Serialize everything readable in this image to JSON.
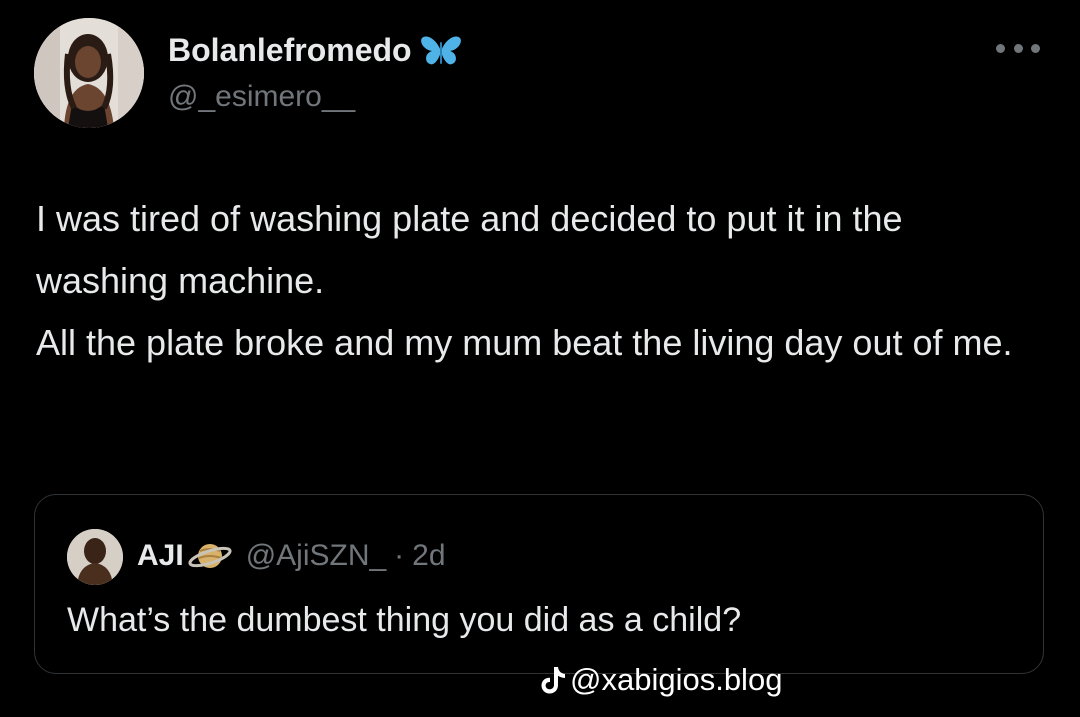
{
  "author": {
    "display_name": "Bolanlefromedo",
    "handle": "@_esimero__",
    "badge_icon": "butterfly-icon",
    "badge_color": "#4fb3e8"
  },
  "tweet": {
    "paragraphs": [
      "I was tired of washing plate and decided to put it in the washing machine.",
      "All the plate broke and my mum beat the living day out of me."
    ]
  },
  "quote": {
    "name": "AJI",
    "badge_icon": "saturn-icon",
    "handle": "@AjiSZN_",
    "separator": "·",
    "time": "2d",
    "text": "What’s the dumbest thing you did as a child?"
  },
  "watermark": {
    "icon": "tiktok-icon",
    "text": "@xabigios.blog"
  },
  "colors": {
    "background": "#000000",
    "primary_text": "#e7e9ea",
    "secondary_text": "#71767b",
    "border": "#2f3336"
  }
}
